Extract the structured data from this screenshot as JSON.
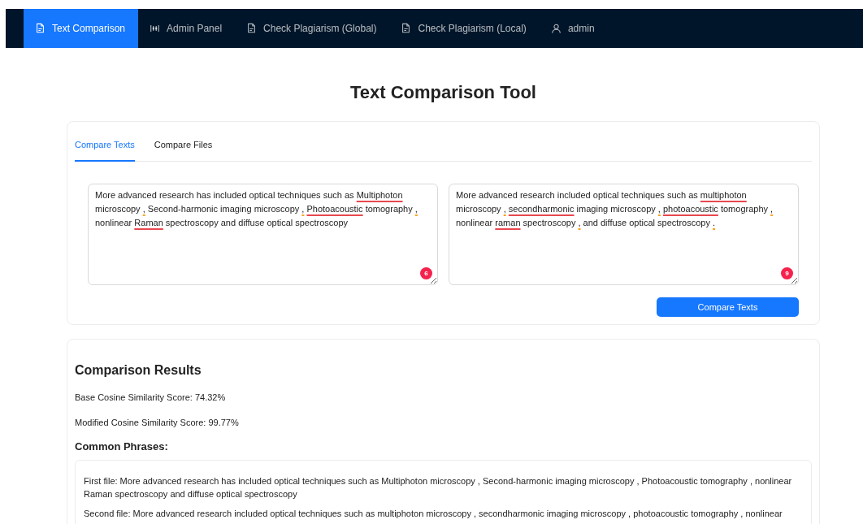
{
  "navbar": {
    "items": [
      {
        "label": "Text Comparison",
        "kind": "document",
        "selected": true
      },
      {
        "label": "Admin Panel",
        "kind": "sliders",
        "selected": false
      },
      {
        "label": "Check Plagiarism (Global)",
        "kind": "document",
        "selected": false
      },
      {
        "label": "Check Plagiarism (Local)",
        "kind": "document",
        "selected": false
      },
      {
        "label": "admin",
        "kind": "user",
        "selected": false
      }
    ]
  },
  "page_title": "Text Comparison Tool",
  "tabs": [
    {
      "label": "Compare Texts",
      "selected": true
    },
    {
      "label": "Compare Files",
      "selected": false
    }
  ],
  "editors": [
    {
      "issue_count": "6",
      "segments": [
        {
          "kind": "plain",
          "text": "More advanced research has included optical techniques such as"
        },
        {
          "kind": "spelling",
          "text": " Multiphoton"
        },
        {
          "kind": "plain",
          "text": " microscopy"
        },
        {
          "kind": "punctuation",
          "text": " ,"
        },
        {
          "kind": "plain",
          "text": " Second-harmonic imaging microscopy"
        },
        {
          "kind": "punctuation",
          "text": " ,"
        },
        {
          "kind": "spelling",
          "text": " Photoacoustic"
        },
        {
          "kind": "plain",
          "text": " tomography"
        },
        {
          "kind": "punctuation",
          "text": " ,"
        },
        {
          "kind": "plain",
          "text": " nonlinear"
        },
        {
          "kind": "spelling",
          "text": " Raman"
        },
        {
          "kind": "plain",
          "text": " spectroscopy and diffuse optical spectroscopy"
        }
      ]
    },
    {
      "issue_count": "9",
      "segments": [
        {
          "kind": "plain",
          "text": "More advanced research included optical techniques such as"
        },
        {
          "kind": "spelling",
          "text": " multiphoton"
        },
        {
          "kind": "plain",
          "text": " microscopy"
        },
        {
          "kind": "punctuation",
          "text": " ,"
        },
        {
          "kind": "spelling",
          "text": " secondharmonic"
        },
        {
          "kind": "plain",
          "text": " imaging microscopy"
        },
        {
          "kind": "punctuation",
          "text": " ,"
        },
        {
          "kind": "spelling",
          "text": " photoacoustic"
        },
        {
          "kind": "plain",
          "text": " tomography"
        },
        {
          "kind": "punctuation",
          "text": " ,"
        },
        {
          "kind": "plain",
          "text": " nonlinear"
        },
        {
          "kind": "spelling",
          "text": " raman"
        },
        {
          "kind": "plain",
          "text": " spectroscopy"
        },
        {
          "kind": "punctuation",
          "text": " ,"
        },
        {
          "kind": "plain",
          "text": " and diffuse optical spectroscopy"
        },
        {
          "kind": "punctuation",
          "text": " ."
        }
      ]
    }
  ],
  "compare_button": "Compare Texts",
  "results": {
    "title": "Comparison Results",
    "scores": [
      "Base Cosine Similarity Score: 74.32%",
      "Modified Cosine Similarity Score: 99.77%"
    ],
    "common_phrases_title": "Common Phrases:",
    "common_phrases": [
      "First file: More advanced research has included optical techniques such as Multiphoton microscopy , Second-harmonic imaging microscopy , Photoacoustic tomography , nonlinear Raman spectroscopy and diffuse optical spectroscopy",
      "Second file: More advanced research included optical techniques such as multiphoton microscopy , secondharmonic imaging microscopy , photoacoustic tomography , nonlinear"
    ]
  }
}
